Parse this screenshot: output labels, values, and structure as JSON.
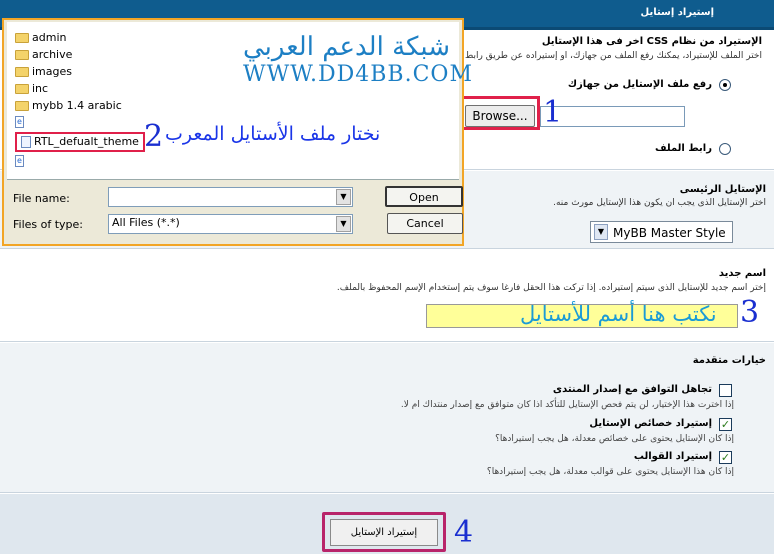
{
  "header": {
    "title": "إستيراد إستايل"
  },
  "import_section": {
    "title": "الإستيراد من نظام CSS اخر فى هذا الإستايل",
    "description": "اختر الملف للإستيراد، يمكنك رفع الملف من جهازك، او إستيراده عن طريق رابط.",
    "upload_label": "رفع ملف الإستايل من جهازك",
    "browse_label": "Browse...",
    "url_label": "رابط الملف"
  },
  "parent_section": {
    "title": "الإستايل الرئيسى",
    "description": "اختر الإستايل الذى يجب ان يكون هذا الإستايل مورث منه.",
    "selected": "MyBB Master Style"
  },
  "name_section": {
    "title": "اسم جديد",
    "description": "إختر اسم جديد للإستايل الذى سيتم إستيراده. إذا تركت هذا الحقل فارغا سوف يتم إستخدام الإسم المحفوظ بالملف."
  },
  "advanced": {
    "title": "خيارات متقدمة",
    "options": [
      {
        "label": "تجاهل التوافق مع إصدار المنتدى",
        "help": "إذا اخترت هذا الإختيار، لن يتم فحص الإستايل للتأكد اذا كان متوافق مع إصدار منتداك ام لا.",
        "checked": false
      },
      {
        "label": "إستيراد خصائص الإستايل",
        "help": "إذا كان الإستايل يحتوى على خصائص معدلة، هل يجب إستيرادها؟",
        "checked": true
      },
      {
        "label": "إستيراد القوالب",
        "help": "إذا كان هذا الإستايل يحتوى على قوالب معدلة، هل يجب إستيرادها؟",
        "checked": true
      }
    ]
  },
  "submit": {
    "label": "إستيراد الإستايل"
  },
  "dialog": {
    "files": [
      {
        "name": "admin",
        "type": "folder"
      },
      {
        "name": "archive",
        "type": "folder"
      },
      {
        "name": "images",
        "type": "folder"
      },
      {
        "name": "inc",
        "type": "folder"
      },
      {
        "name": "mybb 1.4 arabic",
        "type": "folder"
      },
      {
        "name": "RTL_defualt_theme",
        "type": "file"
      }
    ],
    "file_name_label": "File name:",
    "file_name_value": "",
    "files_of_type_label": "Files of type:",
    "files_of_type_value": "All Files (*.*)",
    "open_label": "Open",
    "cancel_label": "Cancel"
  },
  "annotations": {
    "step1": "1",
    "step2": "2",
    "step2_text": "نختار ملف الأستايل المعرب",
    "step3": "3",
    "step3_text": "نكتب هنا أسم للأستايل",
    "step4": "4",
    "watermark_arabic": "شبكة الدعم العربي",
    "watermark_url": "WWW.DD4BB.COM"
  },
  "colors": {
    "header_bg": "#0f5c8e",
    "highlight_red": "#e0204a",
    "annotation_blue": "#1a2fd0",
    "watermark_blue": "#1d7fc4",
    "name_input_bg": "#ffff99"
  }
}
